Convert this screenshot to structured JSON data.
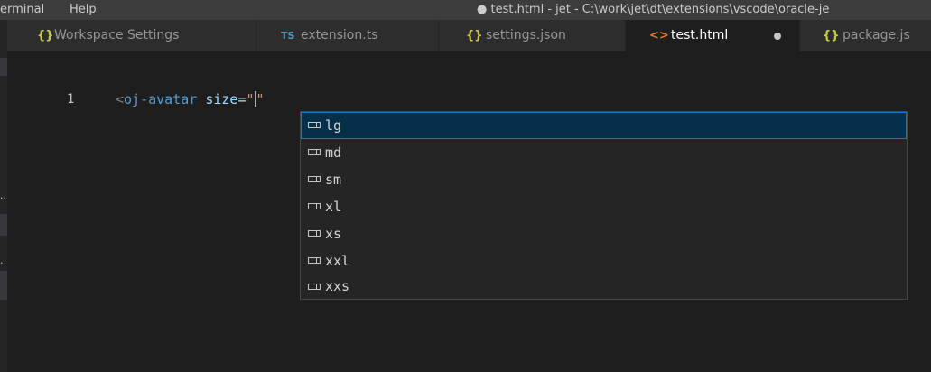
{
  "titlebar": {
    "menus": [
      "erminal",
      "Help"
    ],
    "window_title": "● test.html - jet - C:\\work\\jet\\dt\\extensions\\vscode\\oracle-je"
  },
  "sidebar": {
    "dots": [
      "..",
      "."
    ]
  },
  "tabs": [
    {
      "label": "Workspace Settings",
      "icon": "braces-icon",
      "icon_text": "{}",
      "active": false
    },
    {
      "label": "extension.ts",
      "icon": "typescript-icon",
      "icon_text": "TS",
      "active": false
    },
    {
      "label": "settings.json",
      "icon": "braces-icon",
      "icon_text": "{}",
      "active": false
    },
    {
      "label": "test.html",
      "icon": "html-icon",
      "icon_text": "<>",
      "active": true,
      "dirty": true
    },
    {
      "label": "package.js",
      "icon": "braces-icon",
      "icon_text": "{}",
      "active": false
    }
  ],
  "editor": {
    "line_number": "1",
    "code": {
      "open_bracket": "<",
      "tag": "oj-avatar",
      "space": " ",
      "attr": "size",
      "eq": "=",
      "quote_open": "\"",
      "quote_close": "\""
    }
  },
  "suggestions": {
    "items": [
      "lg",
      "md",
      "sm",
      "xl",
      "xs",
      "xxl",
      "xxs"
    ],
    "selected_index": 0,
    "icon": "enum-value-icon"
  },
  "colors": {
    "background": "#1e1e1e",
    "tabbar": "#252526",
    "tab_inactive": "#2d2d2d",
    "selection": "#062f4a",
    "selection_border": "#007fd4",
    "tag": "#569cd6",
    "attr": "#9cdcfe",
    "string": "#ce9178"
  }
}
